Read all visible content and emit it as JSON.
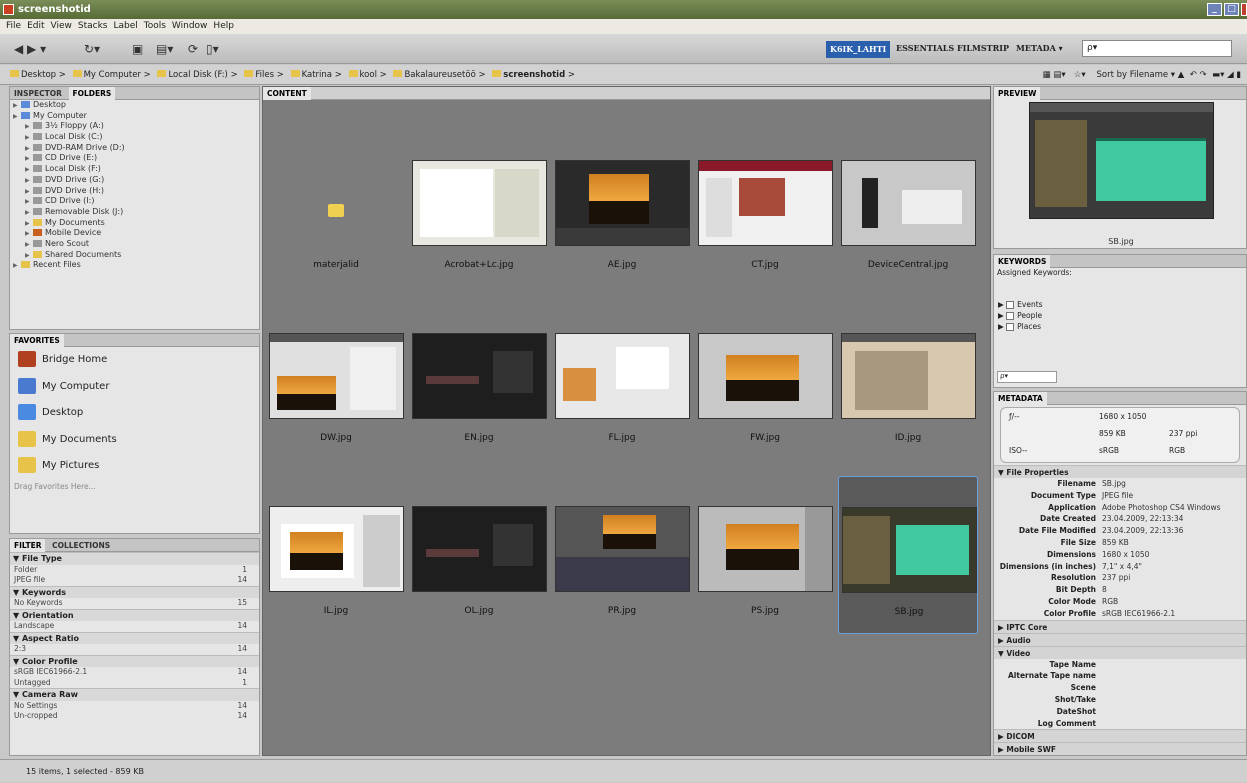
{
  "window": {
    "title": "screenshotid"
  },
  "menu": [
    "File",
    "Edit",
    "View",
    "Stacks",
    "Label",
    "Tools",
    "Window",
    "Help"
  ],
  "workspaces": {
    "active": "K6IK_LAHTI",
    "items": [
      "ESSENTIALS",
      "FILMSTRIP",
      "METADA ▾"
    ]
  },
  "search": {
    "placeholder": "ρ▾"
  },
  "path": [
    "Desktop",
    "My Computer",
    "Local Disk (F:)",
    "Files",
    "Katrina",
    "kool",
    "Bakalaureusetöö",
    "screenshotid"
  ],
  "sort": {
    "label": "Sort by Filename ▾"
  },
  "panels": {
    "inspector": "INSPECTOR",
    "folders": "FOLDERS",
    "favorites": "FAVORITES",
    "filter": "FILTER",
    "collections": "COLLECTIONS",
    "content": "CONTENT",
    "preview": "PREVIEW",
    "keywords": "KEYWORDS",
    "metadata": "METADATA"
  },
  "tree": [
    {
      "label": "Desktop",
      "indent": 0,
      "color": "#5a8ad8"
    },
    {
      "label": "My Computer",
      "indent": 0,
      "color": "#5a8ad8"
    },
    {
      "label": "3½ Floppy (A:)",
      "indent": 1,
      "color": "#999"
    },
    {
      "label": "Local Disk (C:)",
      "indent": 1,
      "color": "#999"
    },
    {
      "label": "DVD-RAM Drive (D:)",
      "indent": 1,
      "color": "#999"
    },
    {
      "label": "CD Drive (E:)",
      "indent": 1,
      "color": "#999"
    },
    {
      "label": "Local Disk (F:)",
      "indent": 1,
      "color": "#999"
    },
    {
      "label": "DVD Drive (G:)",
      "indent": 1,
      "color": "#999"
    },
    {
      "label": "DVD Drive (H:)",
      "indent": 1,
      "color": "#999"
    },
    {
      "label": "CD Drive (I:)",
      "indent": 1,
      "color": "#999"
    },
    {
      "label": "Removable Disk (J:)",
      "indent": 1,
      "color": "#999"
    },
    {
      "label": "My Documents",
      "indent": 1,
      "color": "#e8c34a"
    },
    {
      "label": "Mobile Device",
      "indent": 1,
      "color": "#c86020"
    },
    {
      "label": "Nero Scout",
      "indent": 1,
      "color": "#999"
    },
    {
      "label": "Shared Documents",
      "indent": 1,
      "color": "#e8c34a"
    },
    {
      "label": "Recent Files",
      "indent": 0,
      "color": "#e8c34a"
    }
  ],
  "favorites": [
    {
      "label": "Bridge Home",
      "color": "#b04020"
    },
    {
      "label": "My Computer",
      "color": "#4a7ad0"
    },
    {
      "label": "Desktop",
      "color": "#4a8ae0"
    },
    {
      "label": "My Documents",
      "color": "#e8c34a"
    },
    {
      "label": "My Pictures",
      "color": "#e8c34a"
    }
  ],
  "favorites_hint": "Drag Favorites Here...",
  "filter": [
    {
      "head": "File Type",
      "rows": [
        [
          "Folder",
          "1"
        ],
        [
          "JPEG file",
          "14"
        ]
      ]
    },
    {
      "head": "Keywords",
      "rows": [
        [
          "No Keywords",
          "15"
        ]
      ]
    },
    {
      "head": "Orientation",
      "rows": [
        [
          "Landscape",
          "14"
        ]
      ]
    },
    {
      "head": "Aspect Ratio",
      "rows": [
        [
          "2:3",
          "14"
        ]
      ]
    },
    {
      "head": "Color Profile",
      "rows": [
        [
          "sRGB IEC61966-2.1",
          "14"
        ],
        [
          "Untagged",
          "1"
        ]
      ]
    },
    {
      "head": "Camera Raw",
      "rows": [
        [
          "No Settings",
          "14"
        ],
        [
          "Un-cropped",
          "14"
        ]
      ]
    }
  ],
  "files": [
    {
      "name": "materjalid",
      "kind": "folder"
    },
    {
      "name": "Acrobat+Lc.jpg",
      "kind": "doc"
    },
    {
      "name": "AE.jpg",
      "kind": "sunset"
    },
    {
      "name": "CT.jpg",
      "kind": "web"
    },
    {
      "name": "DeviceCentral.jpg",
      "kind": "device"
    },
    {
      "name": "DW.jpg",
      "kind": "dw"
    },
    {
      "name": "EN.jpg",
      "kind": "dark"
    },
    {
      "name": "FL.jpg",
      "kind": "fl"
    },
    {
      "name": "FW.jpg",
      "kind": "fw"
    },
    {
      "name": "ID.jpg",
      "kind": "id"
    },
    {
      "name": "IL.jpg",
      "kind": "il"
    },
    {
      "name": "OL.jpg",
      "kind": "dark"
    },
    {
      "name": "PR.jpg",
      "kind": "pr"
    },
    {
      "name": "PS.jpg",
      "kind": "ps"
    },
    {
      "name": "SB.jpg",
      "kind": "sb",
      "selected": true
    }
  ],
  "preview": {
    "caption": "SB.jpg"
  },
  "keywords": {
    "assigned": "Assigned Keywords:",
    "items": [
      "Events",
      "People",
      "Places"
    ]
  },
  "meta_summary": {
    "dims": "1680 x 1050",
    "size": "859 KB",
    "ppi": "237 ppi",
    "cs": "sRGB",
    "mode": "RGB",
    "iso": "ISO--",
    "f": "ƒ/--"
  },
  "file_properties": {
    "head": "File Properties",
    "rows": [
      [
        "Filename",
        "SB.jpg"
      ],
      [
        "Document Type",
        "JPEG file"
      ],
      [
        "Application",
        "Adobe Photoshop CS4 Windows"
      ],
      [
        "Date Created",
        "23.04.2009, 22:13:34"
      ],
      [
        "Date File Modified",
        "23.04.2009, 22:13:36"
      ],
      [
        "File Size",
        "859 KB"
      ],
      [
        "Dimensions",
        "1680 x 1050"
      ],
      [
        "Dimensions (in inches)",
        "7,1\" x 4,4\""
      ],
      [
        "Resolution",
        "237 ppi"
      ],
      [
        "Bit Depth",
        "8"
      ],
      [
        "Color Mode",
        "RGB"
      ],
      [
        "Color Profile",
        "sRGB IEC61966-2.1"
      ]
    ]
  },
  "sections": [
    "IPTC Core",
    "Audio",
    "Video"
  ],
  "video_rows": [
    "Tape Name",
    "Alternate Tape name",
    "Scene",
    "Shot/Take",
    "DateShot",
    "Log Comment"
  ],
  "sections2": [
    "DICOM",
    "Mobile SWF"
  ],
  "status": "15 items, 1 selected - 859 KB"
}
